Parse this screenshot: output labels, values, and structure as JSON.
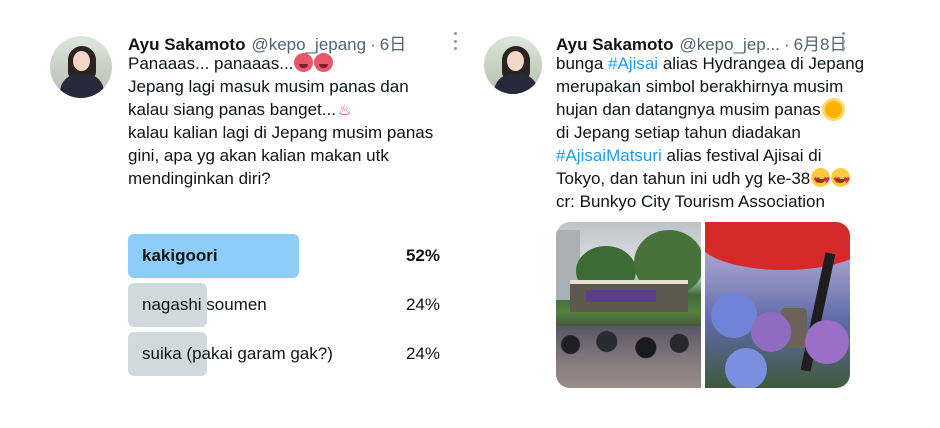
{
  "left_tweet": {
    "name": "Ayu Sakamoto",
    "handle": "@kepo_jepang",
    "separator": "·",
    "date": "6日",
    "text_lines": [
      "Panaaas... panaaas...",
      "Jepang lagi masuk musim panas dan",
      "kalau siang panas banget...",
      "",
      "kalau kalian lagi di Jepang musim panas",
      "gini, apa yg akan kalian makan utk",
      "mendinginkan diri?"
    ],
    "poll": {
      "options": [
        {
          "label": "kakigoori",
          "percent": "52%",
          "fraction": 0.52,
          "winner": true
        },
        {
          "label": "nagashi soumen",
          "percent": "24%",
          "fraction": 0.24,
          "winner": false
        },
        {
          "label": "suika (pakai garam gak?)",
          "percent": "24%",
          "fraction": 0.24,
          "winner": false
        }
      ]
    }
  },
  "right_tweet": {
    "name": "Ayu Sakamoto",
    "handle": "@kepo_jep...",
    "separator": "·",
    "date": "6月8日",
    "line1_pre": "bunga ",
    "line1_tag": "#Ajisai",
    "line1_post": " alias Hydrangea di Jepang",
    "line2": "merupakan simbol berakhirnya musim",
    "line3": "hujan dan datangnya musim panas",
    "line5": "di Jepang setiap tahun diadakan",
    "line6_tag": "#AjisaiMatsuri",
    "line6_post": " alias festival Ajisai di",
    "line7": "Tokyo, dan tahun ini udh yg ke-38",
    "line8": "cr: Bunkyo City Tourism Association"
  },
  "colors": {
    "accent": "#1d9bf0",
    "poll_winner": "#8ecdf7",
    "poll_other": "#cfd9de",
    "secondary_text": "#536471"
  },
  "icons": [
    "more-options-icon",
    "hot-face-emoji",
    "hot-springs-emoji",
    "sun-emoji",
    "heart-eyes-emoji"
  ]
}
